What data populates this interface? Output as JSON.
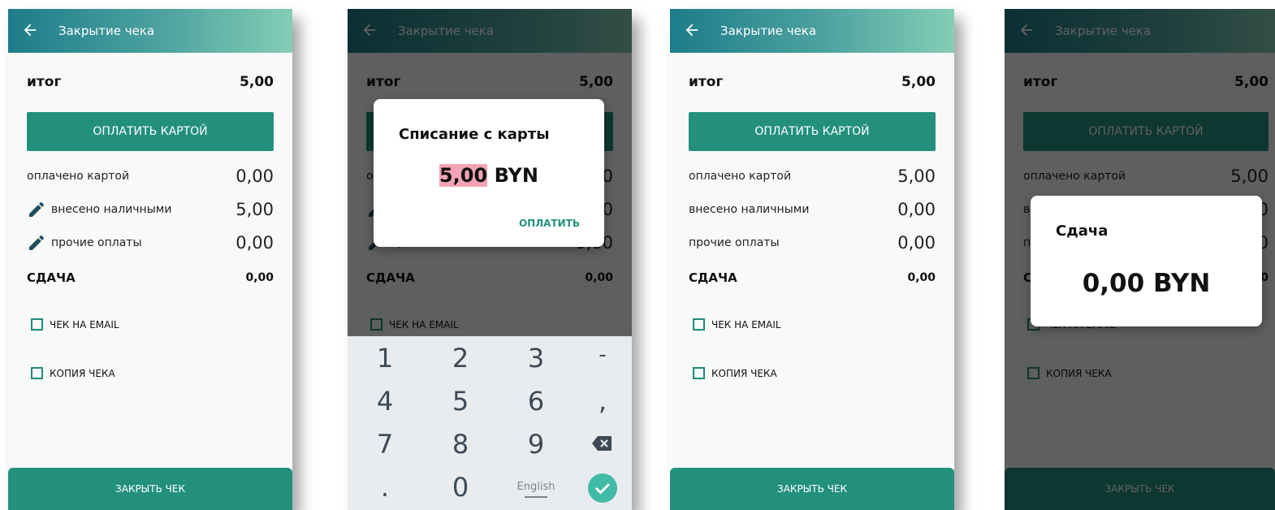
{
  "screen": {
    "title": "Закрытие чека",
    "itog_label": "итог",
    "itog_value": "5,00",
    "pay_card_label": "ОПЛАТИТЬ КАРТОЙ",
    "paid_card_label": "оплачено картой",
    "cash_label": "внесено наличными",
    "other_label": "прочие оплаты",
    "change_label": "СДАЧА",
    "change_value": "0,00",
    "email_label": "ЧЕК НА EMAIL",
    "copy_label": "КОПИЯ ЧЕКА",
    "close_label": "ЗАКРЫТЬ ЧЕК"
  },
  "screen1": {
    "paid_card": "0,00",
    "cash": "5,00",
    "other": "0,00"
  },
  "screen3": {
    "paid_card": "5,00",
    "cash": "0,00",
    "other": "0,00"
  },
  "card_dialog": {
    "title": "Списание с карты",
    "amount": "5,00",
    "currency": "BYN",
    "action": "ОПЛАТИТЬ"
  },
  "keypad": {
    "k1": "1",
    "k2": "2",
    "k3": "3",
    "kminus": "-",
    "k4": "4",
    "k5": "5",
    "k6": "6",
    "kcomma": ",",
    "k7": "7",
    "k8": "8",
    "k9": "9",
    "kdot": ".",
    "k0": "0",
    "lang": "English"
  },
  "change_dialog": {
    "title": "Сдача",
    "amount": "0,00 BYN"
  },
  "colors": {
    "primary": "#23907e",
    "highlight": "#f4a3b7"
  }
}
